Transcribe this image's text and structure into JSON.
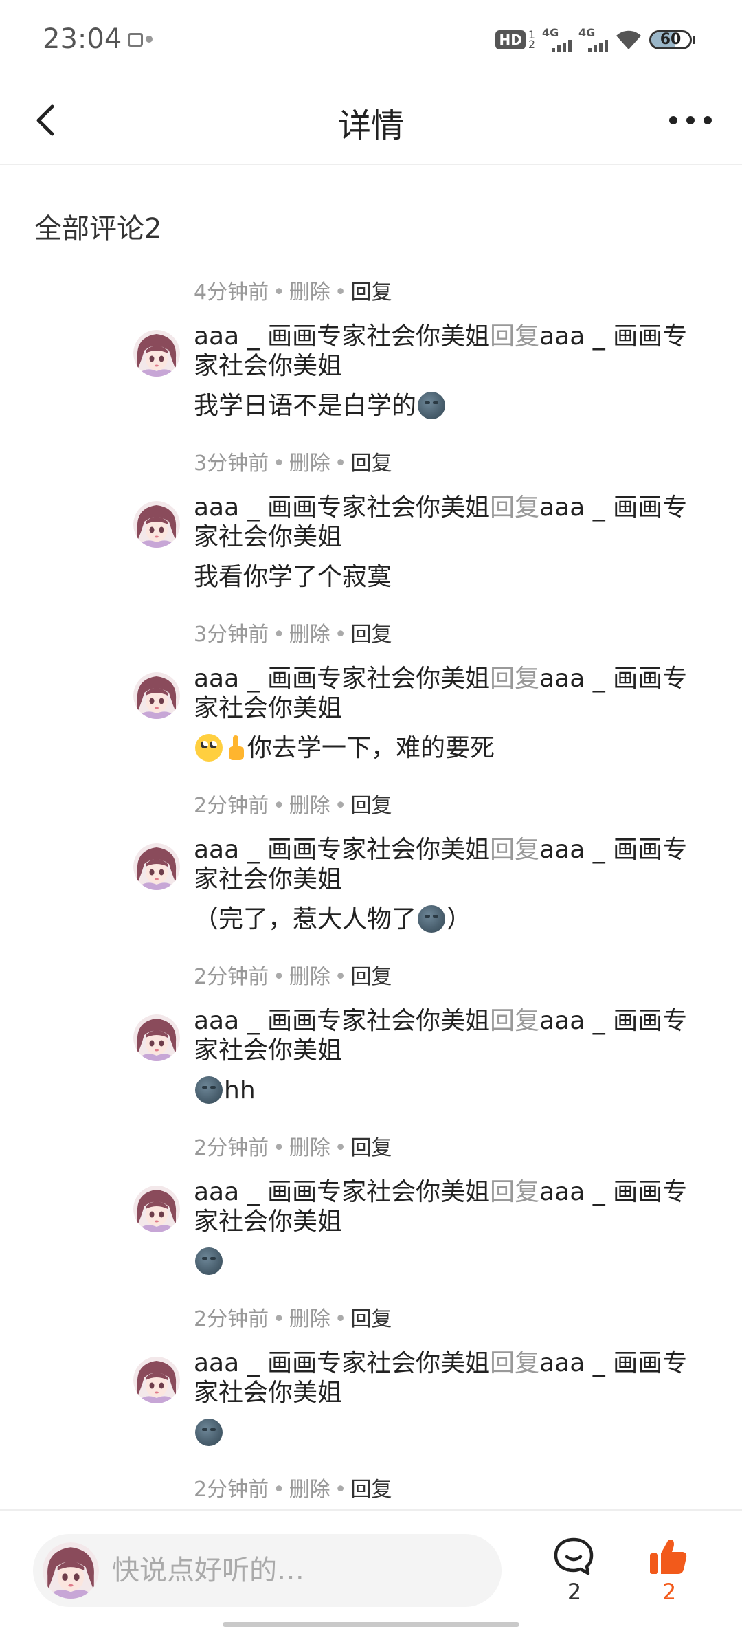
{
  "status_bar": {
    "time": "23:04",
    "hd_badge": "HD",
    "hd_sup_top": "1",
    "hd_sup_bottom": "2",
    "signal_1": "4G",
    "signal_2": "4G",
    "battery": "60",
    "battery_level": 0.6
  },
  "nav": {
    "title": "详情",
    "back_icon": "chevron-left-icon",
    "more_icon": "more-dots-icon"
  },
  "section": {
    "title": "全部评论2"
  },
  "comments": [
    {
      "time": "4分钟前",
      "delete_label": "删除",
      "reply_label": "回复",
      "user": "aaa _ 画画专家社会你美姐",
      "reply_word": "回复",
      "reply_to": "aaa _ 画画专家社会你美姐",
      "text": "我学日语不是白学的"
    },
    {
      "time": "3分钟前",
      "delete_label": "删除",
      "reply_label": "回复",
      "user": "aaa _ 画画专家社会你美姐",
      "reply_word": "回复",
      "reply_to": "aaa _ 画画专家社会你美姐",
      "text": "我看你学了个寂寞"
    },
    {
      "time": "3分钟前",
      "delete_label": "删除",
      "reply_label": "回复",
      "user": "aaa _ 画画专家社会你美姐",
      "reply_word": "回复",
      "reply_to": "aaa _ 画画专家社会你美姐",
      "text": "你去学一下，难的要死"
    },
    {
      "time": "2分钟前",
      "delete_label": "删除",
      "reply_label": "回复",
      "user": "aaa _ 画画专家社会你美姐",
      "reply_word": "回复",
      "reply_to": "aaa _ 画画专家社会你美姐",
      "text_before": "（完了，惹大人物了",
      "text_after": "）"
    },
    {
      "time": "2分钟前",
      "delete_label": "删除",
      "reply_label": "回复",
      "user": "aaa _ 画画专家社会你美姐",
      "reply_word": "回复",
      "reply_to": "aaa _ 画画专家社会你美姐",
      "text": "hh"
    },
    {
      "time": "2分钟前",
      "delete_label": "删除",
      "reply_label": "回复",
      "user": "aaa _ 画画专家社会你美姐",
      "reply_word": "回复",
      "reply_to": "aaa _ 画画专家社会你美姐"
    },
    {
      "time": "2分钟前",
      "delete_label": "删除",
      "reply_label": "回复",
      "user": "aaa _ 画画专家社会你美姐",
      "reply_word": "回复",
      "reply_to": "aaa _ 画画专家社会你美姐"
    }
  ],
  "tail_meta": {
    "time": "2分钟前",
    "delete_label": "删除",
    "reply_label": "回复"
  },
  "bottom_bar": {
    "placeholder": "快说点好听的…",
    "comment_count": "2",
    "like_count": "2",
    "comment_icon": "speech-bubble-icon",
    "like_icon": "thumbs-up-icon",
    "like_color": "#f25a1b"
  },
  "separator": "•"
}
